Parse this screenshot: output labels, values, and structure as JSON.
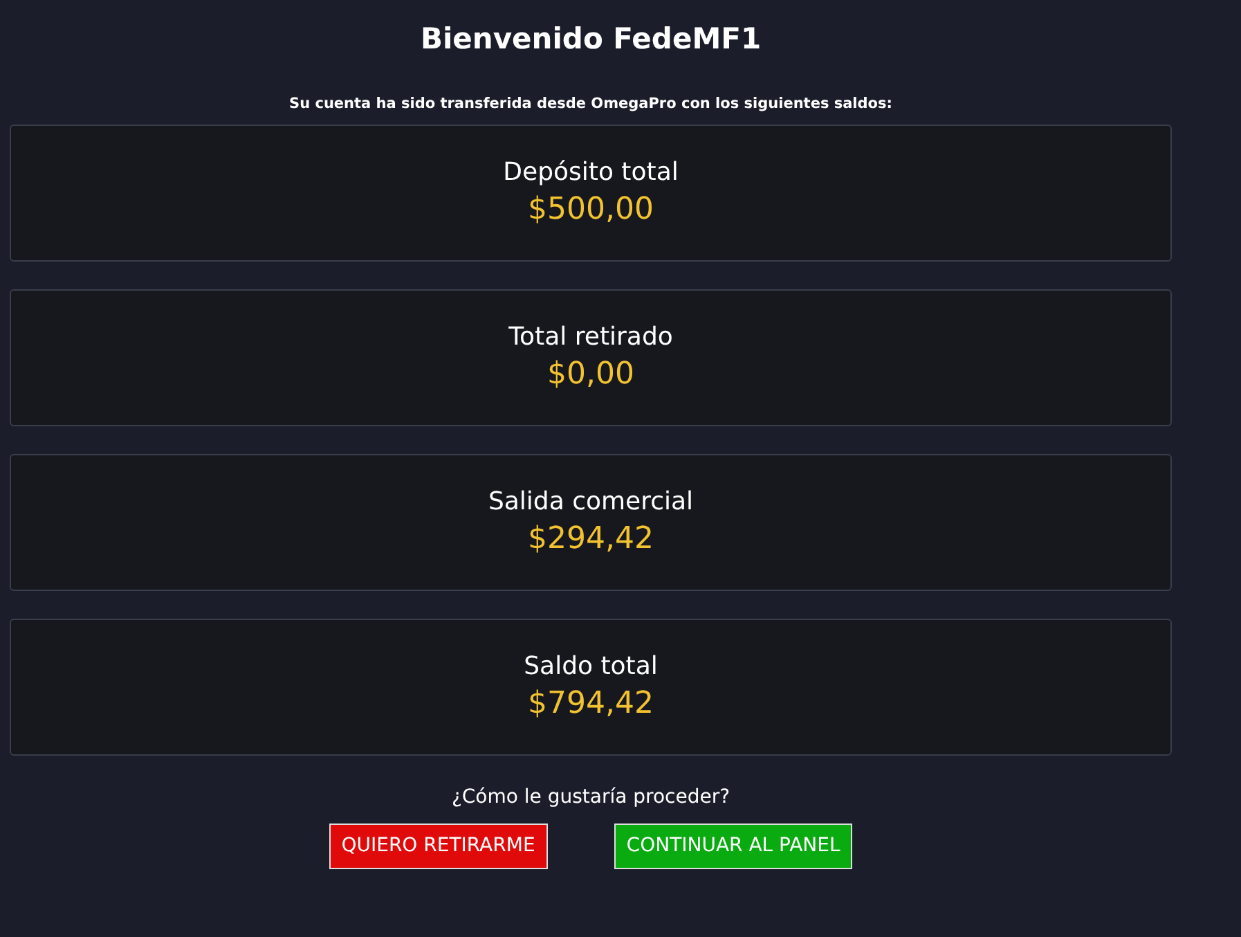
{
  "title": "Bienvenido FedeMF1",
  "subtitle": "Su cuenta ha sido transferida desde OmegaPro con los siguientes saldos:",
  "balances": [
    {
      "label": "Depósito total",
      "amount": "$500,00"
    },
    {
      "label": "Total retirado",
      "amount": "$0,00"
    },
    {
      "label": "Salida comercial",
      "amount": "$294,42"
    },
    {
      "label": "Saldo total",
      "amount": "$794,42"
    }
  ],
  "question": "¿Cómo le gustaría proceder?",
  "buttons": [
    {
      "label": "QUIERO RETIRARME",
      "kind": "danger"
    },
    {
      "label": "CONTINUAR AL PANEL",
      "kind": "success"
    }
  ]
}
